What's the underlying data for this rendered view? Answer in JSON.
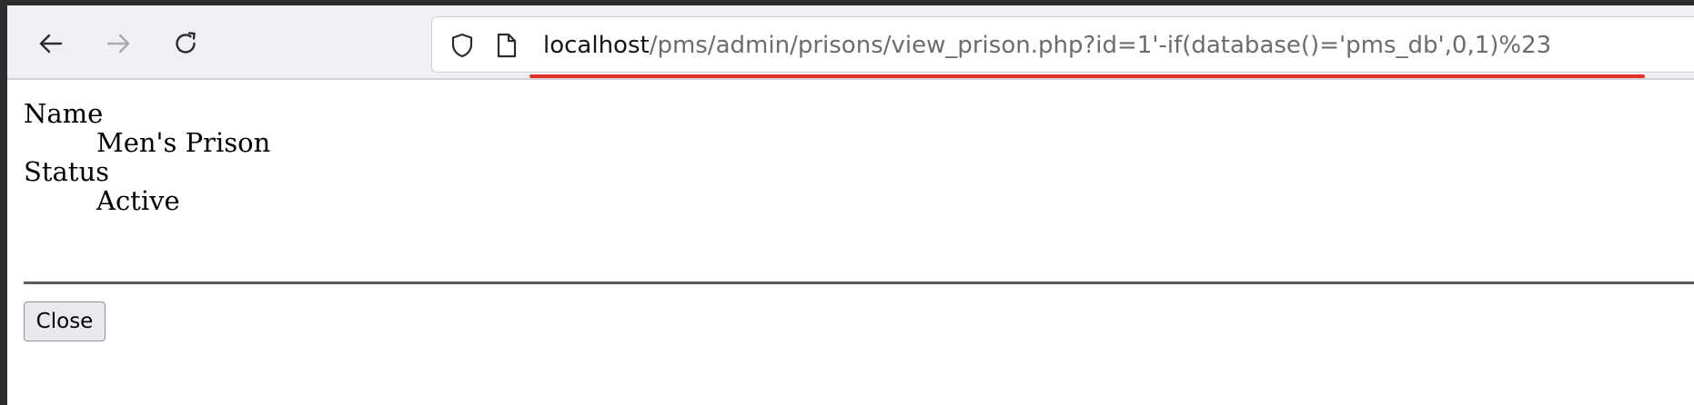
{
  "browser": {
    "url_host": "localhost",
    "url_path": "/pms/admin/prisons/view_prison.php?id=1'-if(database()='pms_db',0,1)%23",
    "icons": {
      "back": "arrow-left-icon",
      "forward": "arrow-right-icon",
      "reload": "reload-icon",
      "security": "shield-icon",
      "page": "page-icon"
    },
    "highlight_color": "#e0322a"
  },
  "details": {
    "name_label": "Name",
    "name_value": "Men's Prison",
    "status_label": "Status",
    "status_value": "Active"
  },
  "actions": {
    "close_label": "Close"
  }
}
